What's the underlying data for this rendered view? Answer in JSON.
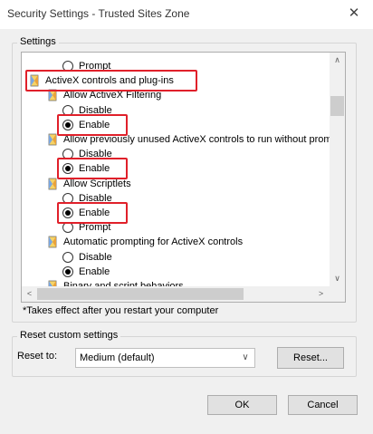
{
  "window": {
    "title": "Security Settings - Trusted Sites Zone",
    "close_glyph": "✕"
  },
  "settings": {
    "group_label": "Settings",
    "rows": [
      {
        "kind": "radio",
        "label": "Prompt",
        "selected": false
      },
      {
        "kind": "category",
        "label": "ActiveX controls and plug-ins",
        "highlighted": true
      },
      {
        "kind": "setting",
        "label": "Allow ActiveX Filtering"
      },
      {
        "kind": "radio",
        "label": "Disable",
        "selected": false
      },
      {
        "kind": "radio",
        "label": "Enable",
        "selected": true,
        "highlighted": true
      },
      {
        "kind": "setting",
        "label": "Allow previously unused ActiveX controls to run without prom"
      },
      {
        "kind": "radio",
        "label": "Disable",
        "selected": false
      },
      {
        "kind": "radio",
        "label": "Enable",
        "selected": true,
        "highlighted": true
      },
      {
        "kind": "setting",
        "label": "Allow Scriptlets"
      },
      {
        "kind": "radio",
        "label": "Disable",
        "selected": false
      },
      {
        "kind": "radio",
        "label": "Enable",
        "selected": true,
        "highlighted": true
      },
      {
        "kind": "radio",
        "label": "Prompt",
        "selected": false
      },
      {
        "kind": "setting",
        "label": "Automatic prompting for ActiveX controls"
      },
      {
        "kind": "radio",
        "label": "Disable",
        "selected": false
      },
      {
        "kind": "radio",
        "label": "Enable",
        "selected": true
      },
      {
        "kind": "setting",
        "label": "Binary and script behaviors"
      }
    ],
    "scroll_up": "∧",
    "scroll_down": "∨",
    "scroll_left": "<",
    "scroll_right": ">",
    "highlight_color": "#e0202a"
  },
  "note": "*Takes effect after you restart your computer",
  "reset": {
    "group_label": "Reset custom settings",
    "label": "Reset to:",
    "dropdown_value": "Medium (default)",
    "button_label": "Reset..."
  },
  "footer": {
    "ok_label": "OK",
    "cancel_label": "Cancel"
  }
}
